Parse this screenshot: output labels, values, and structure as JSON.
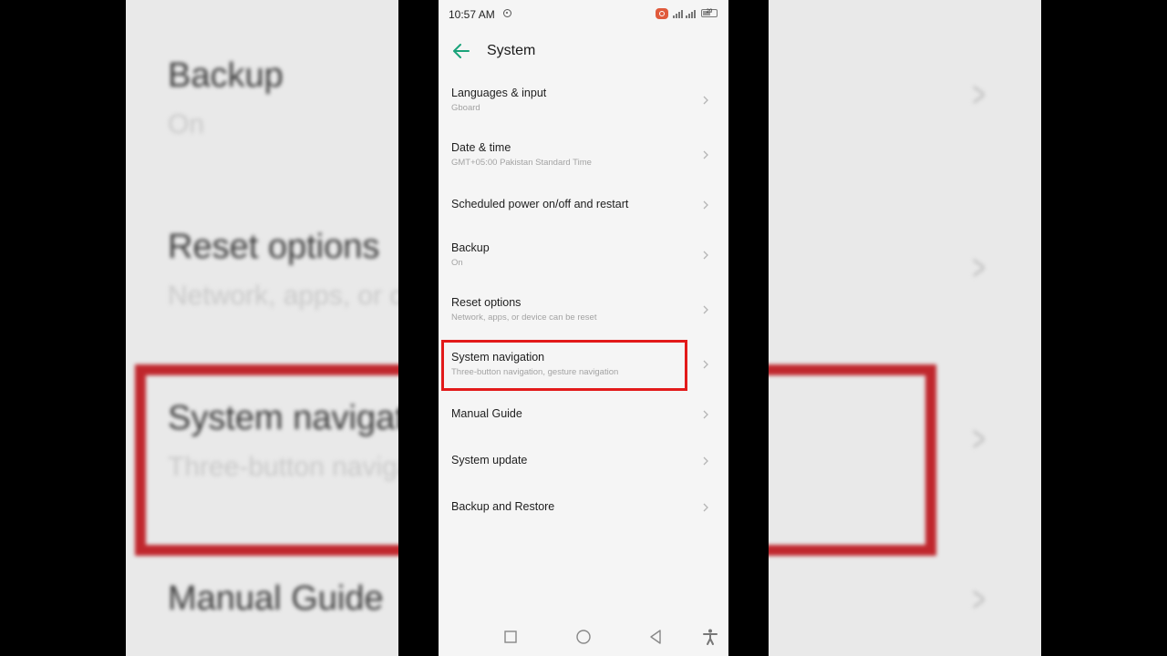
{
  "status_bar": {
    "time": "10:57 AM",
    "battery": "29"
  },
  "header": {
    "title": "System"
  },
  "items": [
    {
      "title": "Languages & input",
      "subtitle": "Gboard"
    },
    {
      "title": "Date & time",
      "subtitle": "GMT+05:00 Pakistan Standard Time"
    },
    {
      "title": "Scheduled power on/off and restart",
      "subtitle": ""
    },
    {
      "title": "Backup",
      "subtitle": "On"
    },
    {
      "title": "Reset options",
      "subtitle": "Network, apps, or device can be reset"
    },
    {
      "title": "System navigation",
      "subtitle": "Three-button navigation, gesture navigation"
    },
    {
      "title": "Manual Guide",
      "subtitle": ""
    },
    {
      "title": "System update",
      "subtitle": ""
    },
    {
      "title": "Backup and Restore",
      "subtitle": ""
    }
  ],
  "background_zoom": {
    "backup_title": "Backup",
    "backup_sub": "On",
    "reset_title": "Reset options",
    "reset_sub": "Network, apps, or device can be reset",
    "sysnav_title": "System navigation",
    "sysnav_sub": "Three-button navigation, gesture navigation",
    "manual_title": "Manual Guide"
  },
  "icons": {
    "back": "arrow-left-icon",
    "chevron": "chevron-right-icon",
    "nav_recents": "square-icon",
    "nav_home": "circle-icon",
    "nav_back": "triangle-back-icon",
    "nav_accessibility": "accessibility-icon"
  },
  "colors": {
    "accent": "#1aa37a",
    "highlight": "#e21a1a",
    "recording": "#e05a3c"
  }
}
